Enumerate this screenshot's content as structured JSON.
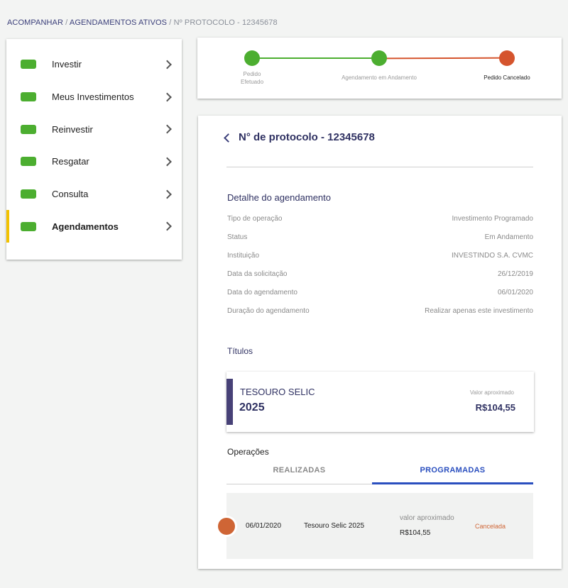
{
  "breadcrumb": {
    "acompanhar": "ACOMPANHAR",
    "separator1": " / ",
    "agendamentos": "AGENDAMENTOS ATIVOS",
    "separator2": " / ",
    "current": "Nº PROTOCOLO - 12345678"
  },
  "sidebar": {
    "items": [
      {
        "label": "Investir",
        "icon": "green-pill-icon",
        "active": false
      },
      {
        "label": "Meus Investimentos",
        "icon": "green-pill-icon",
        "active": false
      },
      {
        "label": "Reinvestir",
        "icon": "green-pill-icon",
        "active": false
      },
      {
        "label": "Resgatar",
        "icon": "green-pill-icon",
        "active": false
      },
      {
        "label": "Consulta",
        "icon": "green-pill-icon",
        "active": false
      },
      {
        "label": "Agendamentos",
        "icon": "green-pill-icon",
        "active": true
      }
    ]
  },
  "progress": {
    "steps": [
      {
        "label_line1": "Pedido",
        "label_line2": "Efetuado",
        "status": "done"
      },
      {
        "label": "Agendamento em Andamento",
        "status": "done"
      },
      {
        "label": "Pedido Cancelado",
        "status": "cancelled"
      }
    ]
  },
  "detail": {
    "protocol_title": "N° de protocolo - 12345678",
    "section_title": "Detalhe do agendamento",
    "rows": [
      {
        "label": "Tipo de operação",
        "value": "Investimento Programado"
      },
      {
        "label": "Status",
        "value": "Em Andamento"
      },
      {
        "label": "Instituição",
        "value": "INVESTINDO S.A. CVMC"
      },
      {
        "label": "Data da solicitação",
        "value": "26/12/2019"
      },
      {
        "label": "Data do agendamento",
        "value": "06/01/2020"
      },
      {
        "label": "Duração do agendamento",
        "value": "Realizar apenas este investimento"
      }
    ]
  },
  "titulos": {
    "section_title": "Títulos",
    "card": {
      "name": "TESOURO SELIC",
      "year": "2025",
      "valor_label": "Valor aproximado",
      "valor": "R$104,55"
    }
  },
  "operacoes": {
    "label": "Operações",
    "tabs": [
      {
        "label": "REALIZADAS",
        "active": false
      },
      {
        "label": "PROGRAMADAS",
        "active": true
      }
    ],
    "rows": [
      {
        "date": "06/01/2020",
        "title": "Tesouro Selic 2025",
        "valor_label": "valor aproximado",
        "valor": "R$104,55",
        "status": "Cancelada"
      }
    ]
  },
  "colors": {
    "green": "#4cae30",
    "orange": "#cf6535",
    "navy": "#2f3162",
    "blue_tab": "#2a4fbf",
    "active_marker": "#f2c200"
  }
}
